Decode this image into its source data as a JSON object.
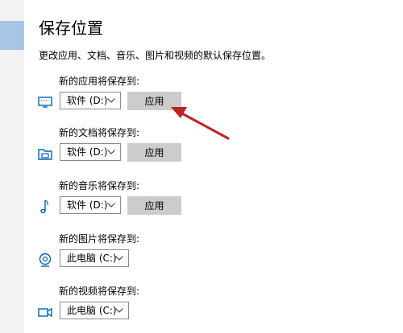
{
  "page": {
    "title": "保存位置",
    "description": "更改应用、文档、音乐、图片和视频的默认保存位置。"
  },
  "groups": [
    {
      "label": "新的应用将保存到:",
      "icon": "monitor-icon",
      "drive": "软件 (D:)",
      "apply_label": "应用"
    },
    {
      "label": "新的文档将保存到:",
      "icon": "folder-icon",
      "drive": "软件 (D:)",
      "apply_label": "应用"
    },
    {
      "label": "新的音乐将保存到:",
      "icon": "music-note-icon",
      "drive": "软件 (D:)",
      "apply_label": "应用"
    },
    {
      "label": "新的图片将保存到:",
      "icon": "camera-icon",
      "drive": "此电脑 (C:)"
    },
    {
      "label": "新的视频将保存到:",
      "icon": "video-camera-icon",
      "drive": "此电脑 (C:)"
    }
  ],
  "colors": {
    "icon_blue": "#0063b1",
    "annotation_red": "#c0201f",
    "button_gray": "#cccccc",
    "sidebar_selected": "#a9c5e6"
  }
}
